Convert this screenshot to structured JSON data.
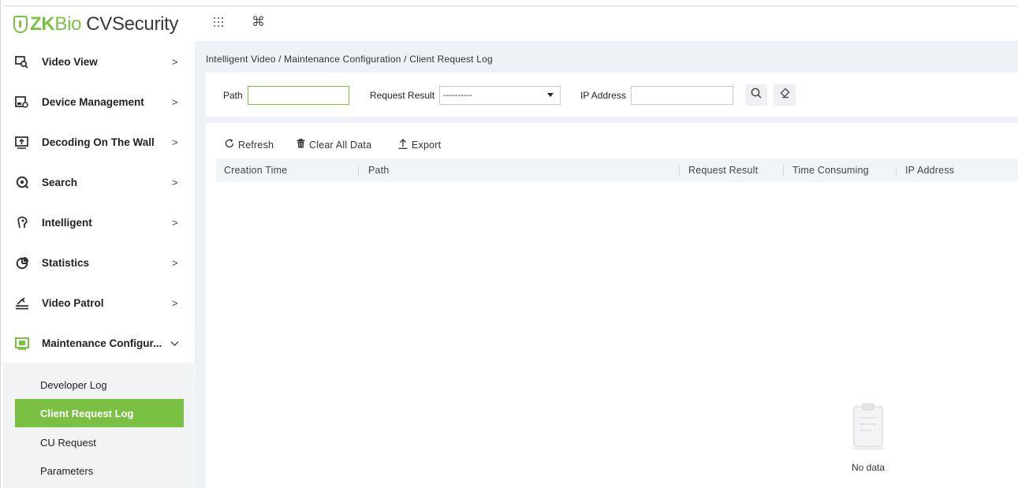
{
  "app": {
    "logo_zk": "ZK",
    "logo_bio": "Bio",
    "logo_cv": "CVSecurity",
    "top_icons": [
      "grid-icon",
      "command-icon"
    ]
  },
  "sidebar": {
    "items": [
      {
        "label": "Video View",
        "icon": "video-view-icon",
        "arrow": ">"
      },
      {
        "label": "Device Management",
        "icon": "device-management-icon",
        "arrow": ">"
      },
      {
        "label": "Decoding On The Wall",
        "icon": "decoding-wall-icon",
        "arrow": ">"
      },
      {
        "label": "Search",
        "icon": "search-menu-icon",
        "arrow": ">"
      },
      {
        "label": "Intelligent",
        "icon": "intelligent-icon",
        "arrow": ">"
      },
      {
        "label": "Statistics",
        "icon": "statistics-icon",
        "arrow": ">"
      },
      {
        "label": "Video Patrol",
        "icon": "video-patrol-icon",
        "arrow": ">"
      },
      {
        "label": "Maintenance Configur...",
        "icon": "maintenance-icon",
        "arrow": "expanded"
      }
    ],
    "submenu": [
      {
        "label": "Developer Log"
      },
      {
        "label": "Client Request Log",
        "active": true
      },
      {
        "label": "CU Request"
      },
      {
        "label": "Parameters"
      }
    ],
    "collapse_glyph": "«"
  },
  "breadcrumb": "Intelligent Video / Maintenance Configuration / Client Request Log",
  "filters": {
    "path_label": "Path",
    "path_value": "",
    "request_result_label": "Request Result",
    "request_result_selected": "----------",
    "ip_label": "IP Address",
    "ip_value": ""
  },
  "toolbar": {
    "refresh": "Refresh",
    "clear_all": "Clear All Data",
    "export": "Export"
  },
  "table": {
    "columns": [
      "Creation Time",
      "Path",
      "Request Result",
      "Time Consuming",
      "IP Address"
    ],
    "rows": []
  },
  "empty_state": {
    "text": "No data"
  },
  "colors": {
    "accent": "#7ac143",
    "main_bg": "#eef1f6",
    "submenu_bg": "#f2f3f5"
  }
}
